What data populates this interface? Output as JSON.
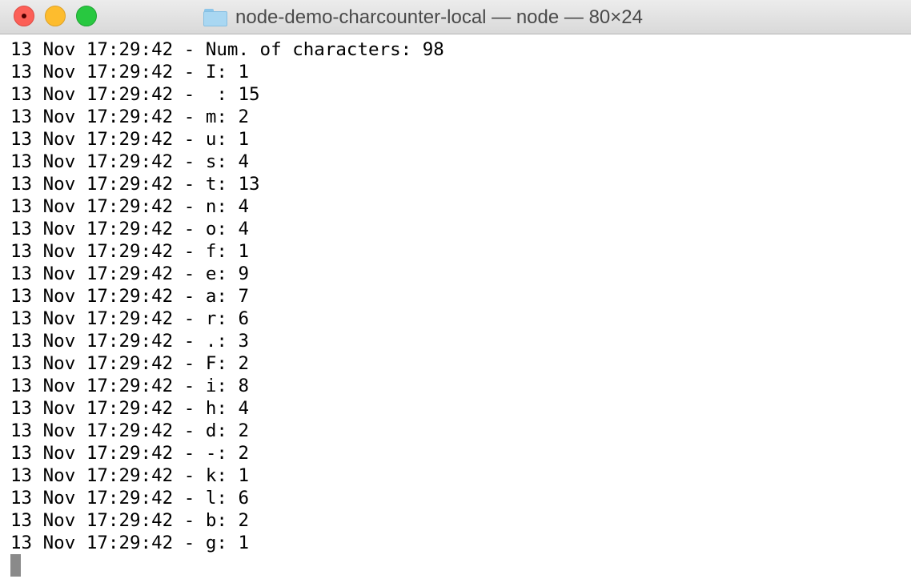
{
  "window": {
    "title": "node-demo-charcounter-local — node — 80×24"
  },
  "terminal": {
    "lines": [
      "13 Nov 17:29:42 - Num. of characters: 98",
      "13 Nov 17:29:42 - I: 1",
      "13 Nov 17:29:42 -  : 15",
      "13 Nov 17:29:42 - m: 2",
      "13 Nov 17:29:42 - u: 1",
      "13 Nov 17:29:42 - s: 4",
      "13 Nov 17:29:42 - t: 13",
      "13 Nov 17:29:42 - n: 4",
      "13 Nov 17:29:42 - o: 4",
      "13 Nov 17:29:42 - f: 1",
      "13 Nov 17:29:42 - e: 9",
      "13 Nov 17:29:42 - a: 7",
      "13 Nov 17:29:42 - r: 6",
      "13 Nov 17:29:42 - .: 3",
      "13 Nov 17:29:42 - F: 2",
      "13 Nov 17:29:42 - i: 8",
      "13 Nov 17:29:42 - h: 4",
      "13 Nov 17:29:42 - d: 2",
      "13 Nov 17:29:42 - -: 2",
      "13 Nov 17:29:42 - k: 1",
      "13 Nov 17:29:42 - l: 6",
      "13 Nov 17:29:42 - b: 2",
      "13 Nov 17:29:42 - g: 1"
    ]
  },
  "colors": {
    "close": "#fc5f57",
    "minimize": "#fdbc2e",
    "zoom": "#28c840",
    "cursor": "#8a8a8a",
    "text": "#000000"
  }
}
